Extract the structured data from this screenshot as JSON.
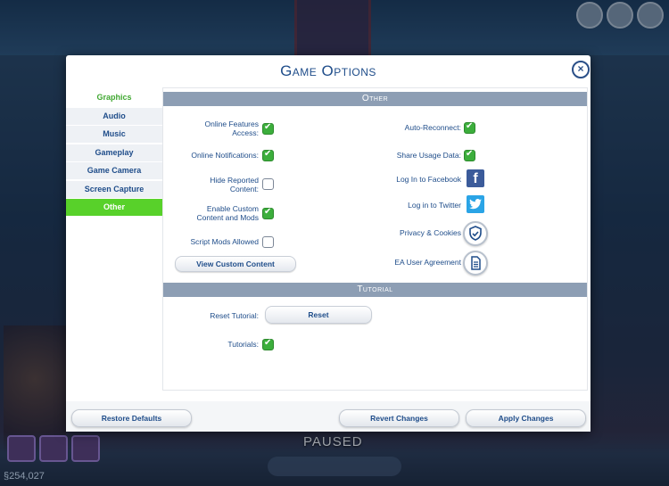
{
  "hud": {
    "paused_label": "PAUSED",
    "funds": "§254,027"
  },
  "dialog": {
    "title": "Game Options",
    "close_label": "×"
  },
  "tabs": [
    {
      "label": "Graphics"
    },
    {
      "label": "Audio"
    },
    {
      "label": "Music"
    },
    {
      "label": "Gameplay"
    },
    {
      "label": "Game Camera"
    },
    {
      "label": "Screen Capture"
    },
    {
      "label": "Other"
    }
  ],
  "other": {
    "header": "Other",
    "online_features_line1": "Online Features",
    "online_features_line2": "Access:",
    "online_features_checked": true,
    "online_notifications": "Online Notifications:",
    "online_notifications_checked": true,
    "hide_reported_line1": "Hide Reported",
    "hide_reported_line2": "Content:",
    "hide_reported_checked": false,
    "enable_custom_line1": "Enable Custom",
    "enable_custom_line2": "Content and Mods",
    "enable_custom_checked": true,
    "script_mods": "Script Mods Allowed",
    "script_mods_checked": false,
    "view_custom_content": "View Custom Content",
    "auto_reconnect": "Auto-Reconnect:",
    "auto_reconnect_checked": true,
    "share_usage": "Share Usage Data:",
    "share_usage_checked": true,
    "facebook": "Log In to Facebook",
    "twitter": "Log in to Twitter",
    "privacy": "Privacy & Cookies",
    "ea_agreement": "EA User Agreement"
  },
  "tutorial": {
    "header": "Tutorial",
    "reset_label": "Reset Tutorial:",
    "reset_button": "Reset",
    "tutorials_label": "Tutorials:",
    "tutorials_checked": true
  },
  "footer": {
    "restore_defaults": "Restore Defaults",
    "revert_changes": "Revert Changes",
    "apply_changes": "Apply Changes"
  },
  "colors": {
    "accent_blue": "#1f4d8a",
    "active_tab_green": "#58d12a",
    "checkbox_green": "#3cae3c",
    "section_header": "#8d9eb4"
  }
}
